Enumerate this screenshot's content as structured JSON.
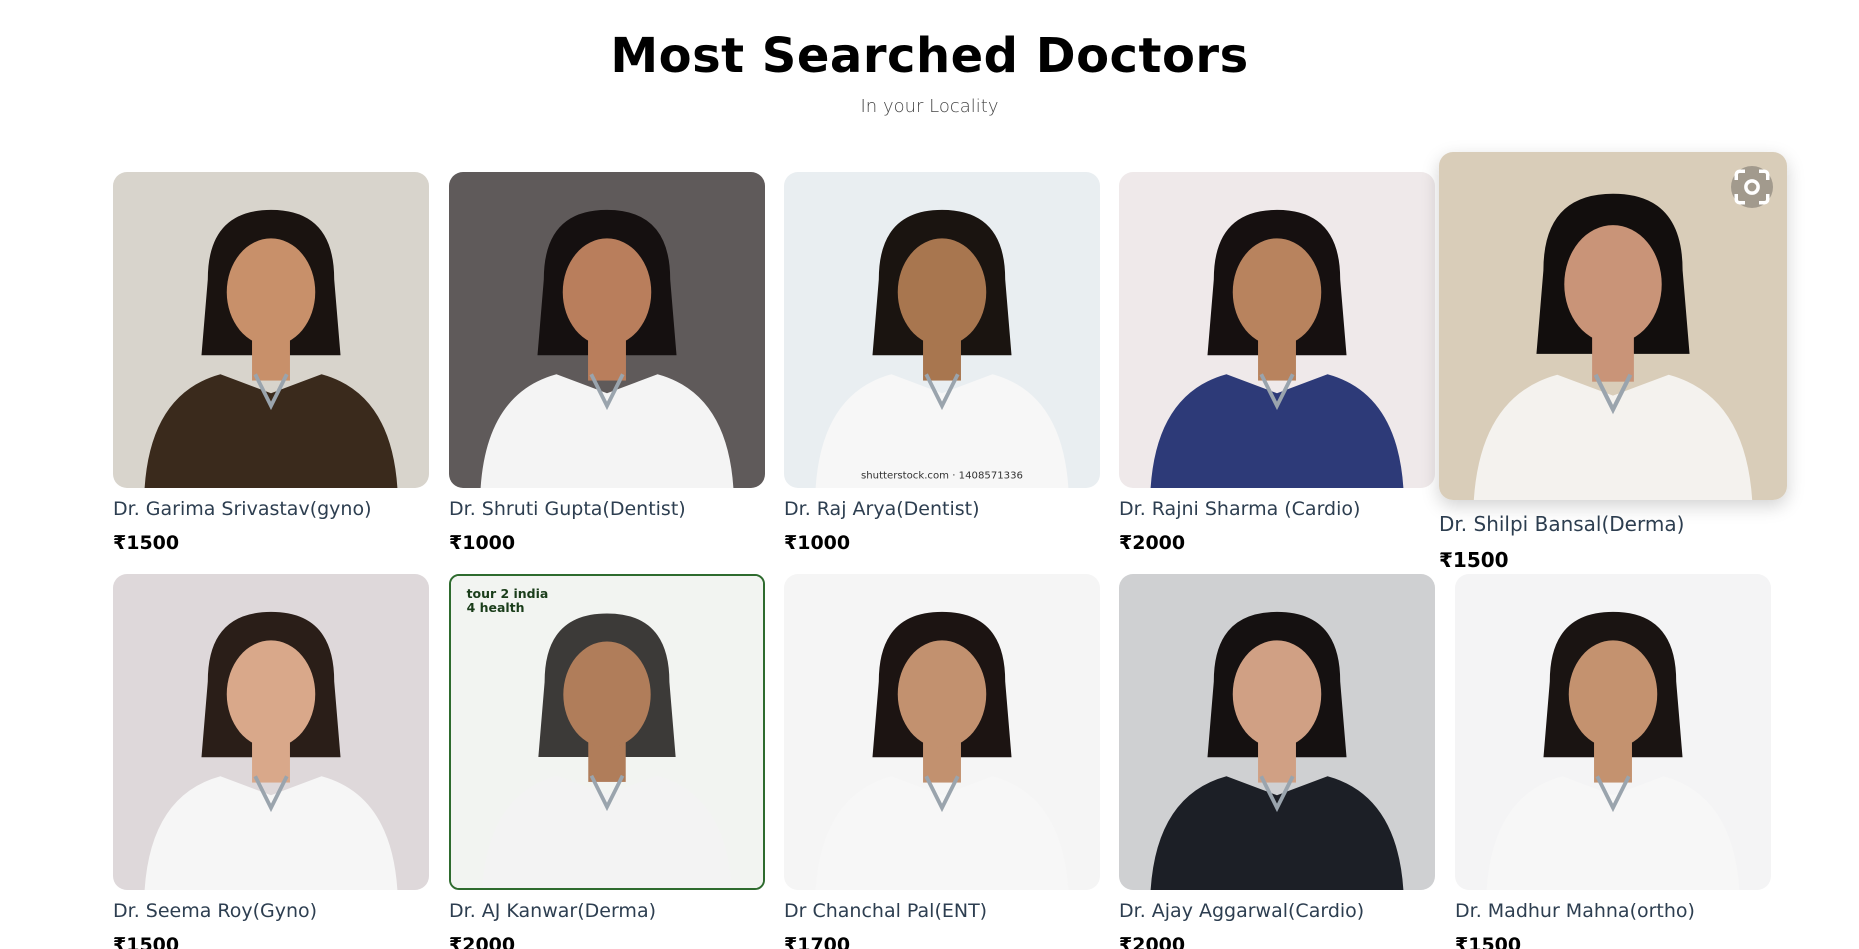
{
  "header": {
    "title": "Most Searched Doctors",
    "subtitle": "In your Locality"
  },
  "doctors": [
    {
      "name": "Dr. Garima Srivastav(gyno)",
      "price": "₹1500",
      "bg": "#d8d4cc",
      "coat": "#3a2a1c",
      "skin": "#c8906a",
      "hair": "#1a1310"
    },
    {
      "name": "Dr. Shruti Gupta(Dentist)",
      "price": "₹1000",
      "bg": "#5f5a5a",
      "coat": "#f4f4f4",
      "skin": "#b97e5c",
      "hair": "#151010"
    },
    {
      "name": "Dr. Raj Arya(Dentist)",
      "price": "₹1000",
      "bg": "#e9eef1",
      "coat": "#f7f7f7",
      "skin": "#a8764f",
      "hair": "#1a1410",
      "watermark": "shutterstock.com · 1408571336"
    },
    {
      "name": "Dr. Rajni Sharma (Cardio)",
      "price": "₹2000",
      "bg": "#efe9ea",
      "coat": "#2d3a78",
      "skin": "#b8835e",
      "hair": "#161010"
    },
    {
      "name": "Dr. Shilpi Bansal(Derma)",
      "price": "₹1500",
      "bg": "#d9cdb9",
      "coat": "#f4f2ee",
      "skin": "#c99478",
      "hair": "#120e0d"
    },
    {
      "name": "Dr. Seema Roy(Gyno)",
      "price": "₹1500",
      "bg": "#ded8da",
      "coat": "#f6f6f6",
      "skin": "#d9a88a",
      "hair": "#2a1e18"
    },
    {
      "name": "Dr. AJ Kanwar(Derma)",
      "price": "₹2000",
      "bg": "#f2f4f1",
      "coat": "#f3f3f3",
      "skin": "#b07d5a",
      "hair": "#3c3a38",
      "badge": "tour 2 india\n4 health"
    },
    {
      "name": "Dr Chanchal Pal(ENT)",
      "price": "₹1700",
      "bg": "#f5f5f5",
      "coat": "#f7f7f7",
      "skin": "#c2916f",
      "hair": "#1c1412"
    },
    {
      "name": "Dr. Ajay Aggarwal(Cardio)",
      "price": "₹2000",
      "bg": "#cfd0d2",
      "coat": "#1c1f26",
      "skin": "#d0a084",
      "hair": "#151111"
    },
    {
      "name": "Dr. Madhur Mahna(ortho)",
      "price": "₹1500",
      "bg": "#f4f4f5",
      "coat": "#f7f7f7",
      "skin": "#c4926f",
      "hair": "#1a1412"
    }
  ],
  "icons": {
    "lens": "google-lens-icon"
  }
}
